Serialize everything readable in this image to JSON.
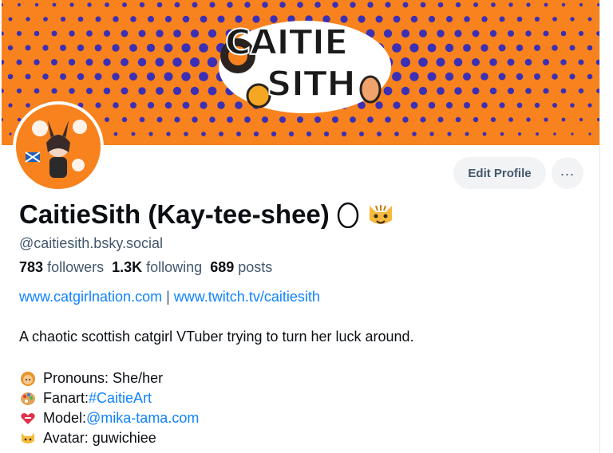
{
  "profile": {
    "display_name": "CaitieSith (Kay-tee-shee)",
    "handle": "@caitiesith.bsky.social",
    "followers_count": "783",
    "followers_label": "followers",
    "following_count": "1.3K",
    "following_label": "following",
    "posts_count": "689",
    "posts_label": "posts",
    "link1": "www.catgirlnation.com",
    "separator": "|",
    "link2": "www.twitch.tv/caitiesith",
    "bio": "A chaotic scottish catgirl VTuber trying to turn her luck around.",
    "details": [
      {
        "icon": "woman-emoji-icon",
        "label": "Pronouns: She/her",
        "value": ""
      },
      {
        "icon": "palette-emoji-icon",
        "label": "Fanart: ",
        "value": "#CaitieArt"
      },
      {
        "icon": "heart-emoji-icon",
        "label": "Model: ",
        "value": "@mika-tama.com"
      },
      {
        "icon": "cat-emoji-icon",
        "label": "Avatar: guwichiee",
        "value": ""
      }
    ]
  },
  "banner": {
    "logo_line1": "CAITIE",
    "logo_line2": "SITH",
    "colors": {
      "background": "#f7821e",
      "dots": "#3b2fb5"
    }
  },
  "actions": {
    "edit_label": "Edit Profile",
    "more_label": "..."
  },
  "colors": {
    "accent": "#1083fe",
    "muted": "#42576c"
  }
}
